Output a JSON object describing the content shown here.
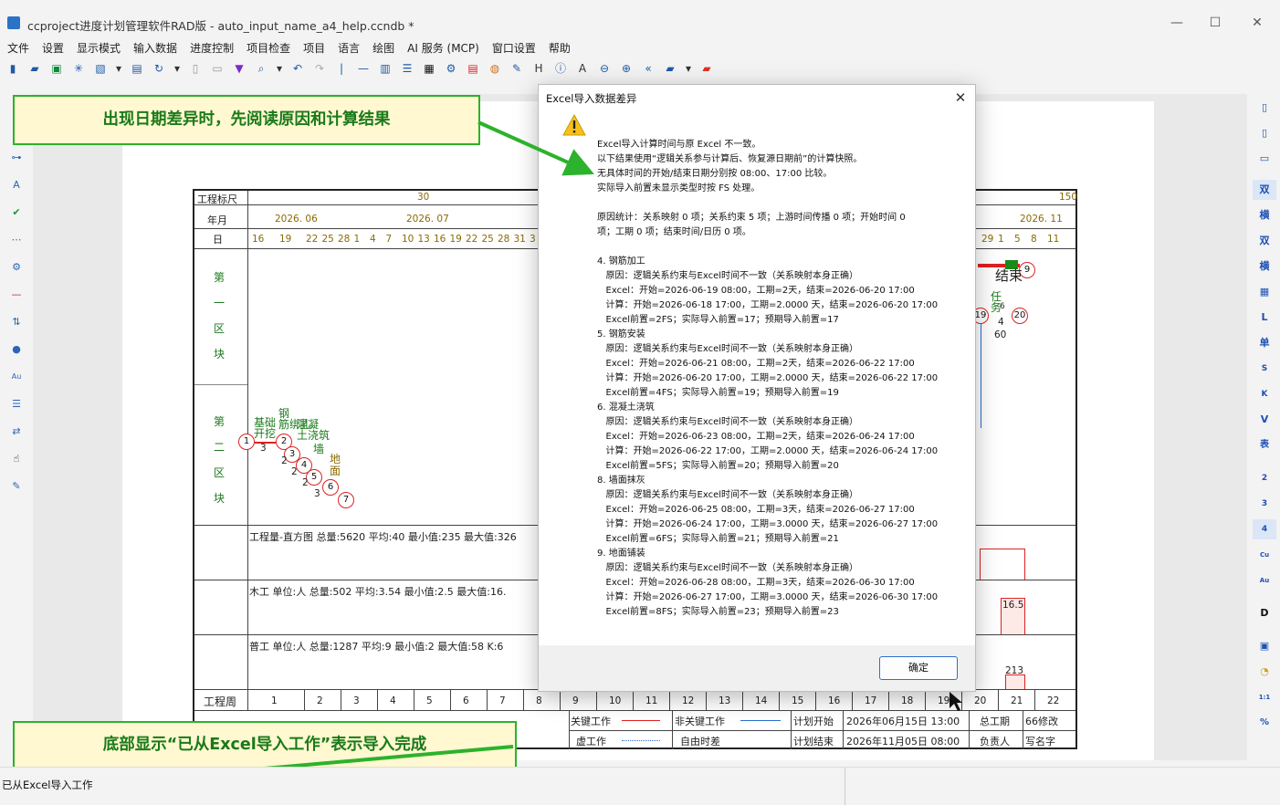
{
  "window": {
    "title": "ccproject进度计划管理软件RAD版 - auto_input_name_a4_help.ccndb *"
  },
  "menu": [
    "文件",
    "设置",
    "显示模式",
    "输入数据",
    "进度控制",
    "项目检查",
    "项目",
    "语言",
    "绘图",
    "AI 服务 (MCP)",
    "窗口设置",
    "帮助"
  ],
  "chart": {
    "rows": {
      "scale": "工程标尺",
      "month": "年月",
      "day": "日",
      "week": "工程周"
    },
    "scale_values": [
      "30",
      "150"
    ],
    "months": [
      "2026. 06",
      "2026. 07",
      "2026. 11"
    ],
    "days": [
      "16",
      "19",
      "22",
      "25",
      "28",
      "1",
      "4",
      "7",
      "10",
      "13",
      "16",
      "19",
      "22",
      "25",
      "28",
      "31",
      "3"
    ],
    "days_right": [
      "29",
      "1",
      "5",
      "8",
      "11"
    ],
    "blocks": {
      "first": "第\n\n一\n\n区\n\n块",
      "second": "第\n\n二\n\n区\n\n块"
    },
    "resource_lines": [
      "工程量-直方图  总量:5620  平均:40  最小值:235  最大值:326",
      "木工  单位:人  总量:502  平均:3.54  最小值:2.5  最大值:16.",
      "普工  单位:人  总量:1287  平均:9  最小值:2  最大值:58  K:6"
    ],
    "weeks": [
      "1",
      "2",
      "3",
      "4",
      "5",
      "6",
      "7",
      "8",
      "9",
      "10",
      "11",
      "12",
      "13",
      "14",
      "15",
      "16",
      "17",
      "18",
      "19",
      "20",
      "21",
      "22"
    ],
    "hist_values": [
      "16.5",
      "213"
    ],
    "legend": {
      "critical": "关键工作",
      "noncritical": "非关键工作",
      "virtual": "虚工作",
      "free_float": "自由时差",
      "plan_start_label": "计划开始",
      "plan_start": "2026年06月15日  13:00",
      "plan_end_label": "计划结束",
      "plan_end": "2026年11月05日  08:00",
      "total_label": "总工期",
      "total": "66修改",
      "owner_label": "负责人",
      "sign": "写名字"
    },
    "tasks": {
      "foundation": "基础\n开挖",
      "rebar": "钢\n筋绑扎",
      "concrete": "混凝\n土浇筑",
      "wall": "墙",
      "floor": "地\n面",
      "end": "结束",
      "task": "任\n务"
    },
    "node_numbers": [
      "1",
      "2",
      "3",
      "4",
      "5",
      "6",
      "7",
      "19",
      "20",
      "9"
    ],
    "durations": [
      "3",
      "2",
      "2",
      "2",
      "2",
      "3",
      "4",
      "60",
      "6"
    ]
  },
  "dialog": {
    "title": "Excel导入数据差异",
    "text": "Excel导入计算时间与原 Excel 不一致。\n以下结果使用“逻辑关系参与计算后、恢复源日期前”的计算快照。\n无具体时间的开始/结束日期分别按 08:00、17:00 比较。\n实际导入前置未显示类型时按 FS 处理。\n\n原因统计：关系映射 0 项；关系约束 5 项；上游时间传播 0 项；开始时间 0\n项；工期 0 项；结束时间/日历 0 项。\n\n4. 钢筋加工\n   原因：逻辑关系约束与Excel时间不一致（关系映射本身正确）\n   Excel：开始=2026-06-19 08:00，工期=2天，结束=2026-06-20 17:00\n   计算：开始=2026-06-18 17:00，工期=2.0000 天，结束=2026-06-20 17:00\n   Excel前置=2FS；实际导入前置=17；预期导入前置=17\n5. 钢筋安装\n   原因：逻辑关系约束与Excel时间不一致（关系映射本身正确）\n   Excel：开始=2026-06-21 08:00，工期=2天，结束=2026-06-22 17:00\n   计算：开始=2026-06-20 17:00，工期=2.0000 天，结束=2026-06-22 17:00\n   Excel前置=4FS；实际导入前置=19；预期导入前置=19\n6. 混凝土浇筑\n   原因：逻辑关系约束与Excel时间不一致（关系映射本身正确）\n   Excel：开始=2026-06-23 08:00，工期=2天，结束=2026-06-24 17:00\n   计算：开始=2026-06-22 17:00，工期=2.0000 天，结束=2026-06-24 17:00\n   Excel前置=5FS；实际导入前置=20；预期导入前置=20\n8. 墙面抹灰\n   原因：逻辑关系约束与Excel时间不一致（关系映射本身正确）\n   Excel：开始=2026-06-25 08:00，工期=3天，结束=2026-06-27 17:00\n   计算：开始=2026-06-24 17:00，工期=3.0000 天，结束=2026-06-27 17:00\n   Excel前置=6FS；实际导入前置=21；预期导入前置=21\n9. 地面铺装\n   原因：逻辑关系约束与Excel时间不一致（关系映射本身正确）\n   Excel：开始=2026-06-28 08:00，工期=3天，结束=2026-06-30 17:00\n   计算：开始=2026-06-27 17:00，工期=3.0000 天，结束=2026-06-30 17:00\n   Excel前置=8FS；实际导入前置=23；预期导入前置=23",
    "ok": "确定"
  },
  "callouts": {
    "top": "出现日期差异时，先阅读原因和计算结果",
    "bottom": "底部显示“已从Excel导入工作”表示导入完成"
  },
  "status": {
    "text": "已从Excel导入工作"
  },
  "right_tools": [
    "双",
    "横",
    "双",
    "横",
    "L",
    "单",
    "S",
    "K",
    "V",
    "表",
    "2",
    "3",
    "4",
    "Cu",
    "Au",
    "D"
  ],
  "colors": {
    "critical": "#e02020",
    "noncritical": "#2a6fd0",
    "callout_border": "#2cb22c",
    "callout_bg": "#fff8d0"
  }
}
